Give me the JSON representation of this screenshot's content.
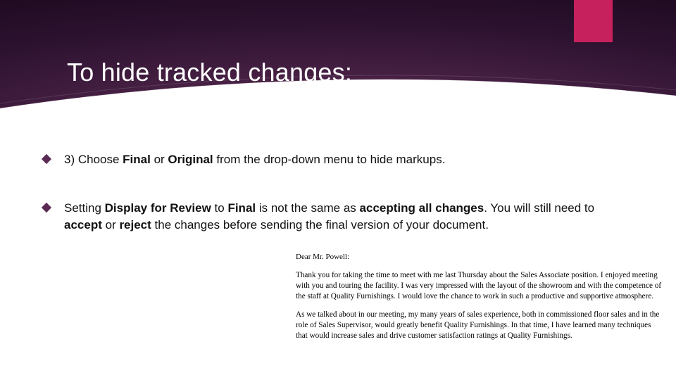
{
  "colors": {
    "accent": "#c7215d",
    "header_dark": "#1a0818",
    "header_mid": "#4a2246",
    "bullet_diamond": "#5a2a52"
  },
  "title": "To hide tracked changes:",
  "bullets": [
    {
      "prefix": "3) Choose ",
      "bold1": "Final",
      "mid1": " or ",
      "bold2": "Original",
      "suffix": " from the drop-down menu to hide markups."
    },
    {
      "t1": "Setting ",
      "b1": "Display for Review",
      "t2": " to ",
      "b2": "Final",
      "t3": " is not the same as ",
      "b3": "accepting all changes",
      "t4": ". You will still need to ",
      "b4": "accept",
      "t5": " or ",
      "b5": "reject",
      "t6": " the changes before sending the final version of your document."
    }
  ],
  "sample_doc": {
    "greeting": "Dear Mr. Powell:",
    "para1": "Thank you for taking the time to meet with me last Thursday about the Sales Associate position. I enjoyed meeting with you and touring the facility. I was very impressed with the layout of the showroom and with the competence of the staff at Quality Furnishings. I would love the chance to work in such a productive and supportive atmosphere.",
    "para2": "As we talked about in our meeting, my many years of sales experience, both in commissioned floor sales and in the role of Sales Supervisor, would greatly benefit Quality Furnishings. In that time, I have learned many techniques that would increase sales and drive customer satisfaction ratings at Quality Furnishings."
  }
}
